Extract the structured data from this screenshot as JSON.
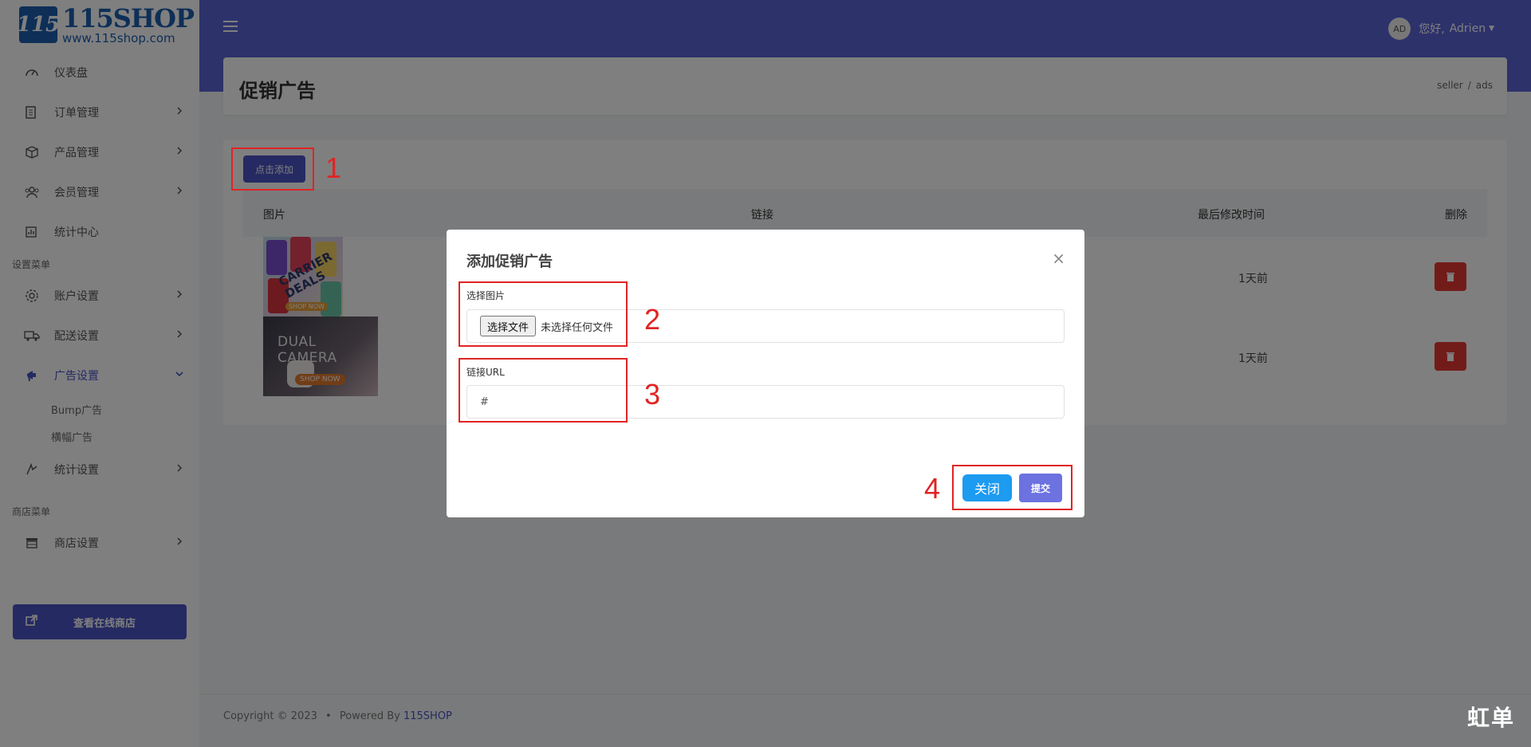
{
  "sidebar": {
    "logo": {
      "mark": "115",
      "name": "115SHOP",
      "url": "www.115shop.com"
    },
    "items": [
      {
        "label": "仪表盘",
        "icon": "dashboard-icon",
        "has_chevron": false
      },
      {
        "label": "订单管理",
        "icon": "orders-icon",
        "has_chevron": true
      },
      {
        "label": "产品管理",
        "icon": "box-icon",
        "has_chevron": true
      },
      {
        "label": "会员管理",
        "icon": "users-icon",
        "has_chevron": true
      },
      {
        "label": "统计中心",
        "icon": "stats-icon",
        "has_chevron": false
      }
    ],
    "section_settings": "设置菜单",
    "settings_items": [
      {
        "label": "账户设置",
        "icon": "gear-icon"
      },
      {
        "label": "配送设置",
        "icon": "truck-icon"
      },
      {
        "label": "广告设置",
        "icon": "megaphone-icon",
        "active": true
      }
    ],
    "ad_sub_items": [
      "Bump广告",
      "横幅广告"
    ],
    "stats_settings": {
      "label": "统计设置",
      "icon": "analytics-icon"
    },
    "section_shop": "商店菜单",
    "shop_items": [
      {
        "label": "商店设置",
        "icon": "store-icon"
      }
    ],
    "view_shop_button": "查看在线商店"
  },
  "header": {
    "greeting": "您好,",
    "user_name": "Adrien",
    "avatar_initials": "AD"
  },
  "page": {
    "title": "促销广告",
    "breadcrumb": [
      "seller",
      "ads"
    ]
  },
  "content": {
    "add_button": "点击添加",
    "columns": {
      "image": "图片",
      "link": "链接",
      "modified": "最后修改时间",
      "delete": "删除"
    },
    "rows": [
      {
        "image": "CARRIER DEALS",
        "image_badge": "SHOP NOW",
        "modified": "1天前"
      },
      {
        "image": "DUAL CAMERA",
        "image_badge": "SHOP NOW",
        "modified": "1天前"
      }
    ]
  },
  "modal": {
    "title": "添加促销广告",
    "close_glyph": "×",
    "image_label": "选择图片",
    "file_button": "选择文件",
    "file_status": "未选择任何文件",
    "url_label": "链接URL",
    "url_value": "#",
    "close_button": "关闭",
    "submit_button": "提交"
  },
  "annotations": [
    "1",
    "2",
    "3",
    "4"
  ],
  "footer": {
    "copyright": "Copyright © 2023",
    "powered": "Powered By",
    "brand": "115SHOP"
  },
  "watermark": "虹单",
  "colors": {
    "primary": "#4a55c4",
    "header": "#5a64d6",
    "danger": "#e53935",
    "annotation": "#e02424",
    "close_btn": "#1d9bf0"
  }
}
